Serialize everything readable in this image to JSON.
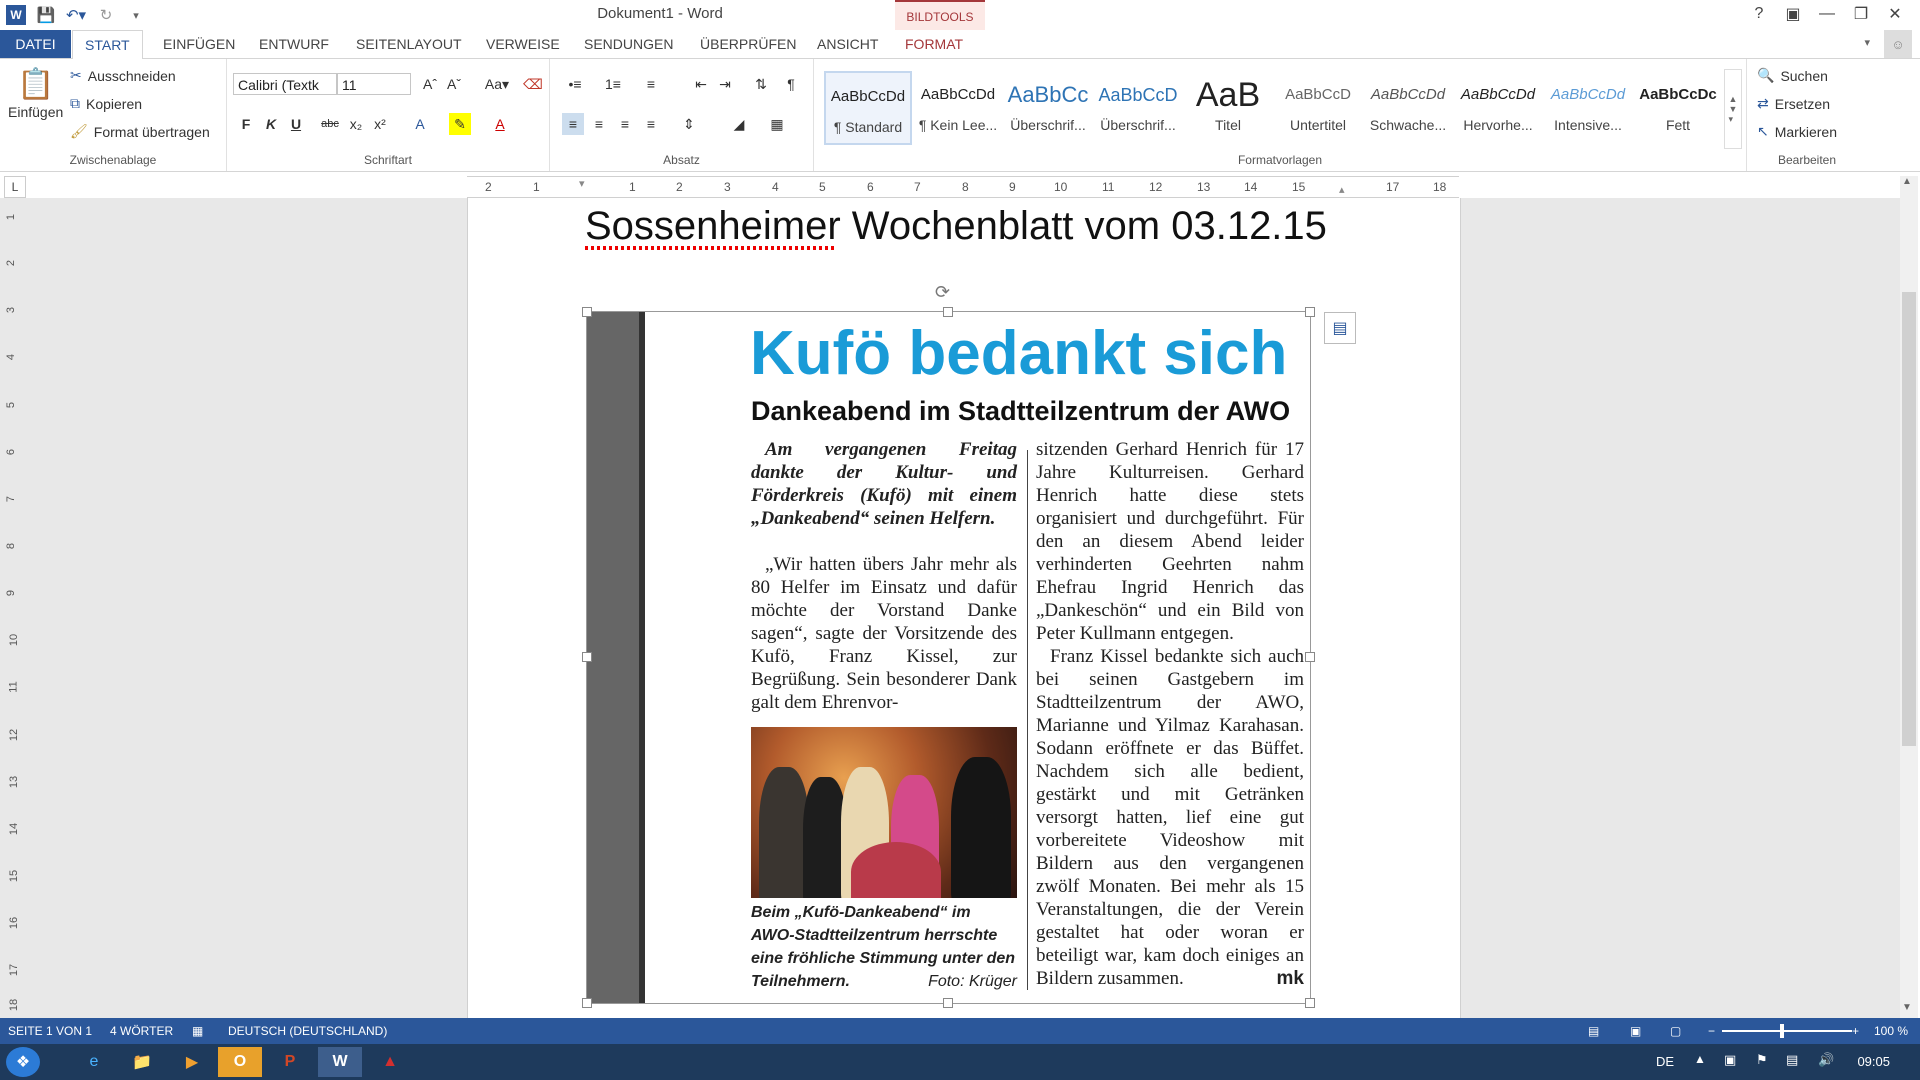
{
  "window": {
    "title": "Dokument1 - Word",
    "contextual_tab_group": "BILDTOOLS",
    "help": "?",
    "controls": [
      "restore-ribbon",
      "minimize",
      "maximize",
      "close"
    ]
  },
  "tabs": [
    "DATEI",
    "START",
    "EINFÜGEN",
    "ENTWURF",
    "SEITENLAYOUT",
    "VERWEISE",
    "SENDUNGEN",
    "ÜBERPRÜFEN",
    "ANSICHT",
    "FORMAT"
  ],
  "active_tab": "START",
  "ribbon": {
    "clipboard": {
      "paste": "Einfügen",
      "cut": "Ausschneiden",
      "copy": "Kopieren",
      "format_painter": "Format übertragen",
      "label": "Zwischenablage"
    },
    "font": {
      "name": "Calibri (Textk",
      "size": "11",
      "bold": "F",
      "italic": "K",
      "underline": "U",
      "strike": "abc",
      "sub": "x₂",
      "sup": "x²",
      "label": "Schriftart"
    },
    "paragraph": {
      "label": "Absatz"
    },
    "styles": {
      "label": "Formatvorlagen",
      "items": [
        {
          "sample": "AaBbCcDd",
          "name": "¶ Standard"
        },
        {
          "sample": "AaBbCcDd",
          "name": "¶ Kein Lee..."
        },
        {
          "sample": "AaBbCc",
          "name": "Überschrif..."
        },
        {
          "sample": "AaBbCcD",
          "name": "Überschrif..."
        },
        {
          "sample": "AaB",
          "name": "Titel"
        },
        {
          "sample": "AaBbCcD",
          "name": "Untertitel"
        },
        {
          "sample": "AaBbCcDd",
          "name": "Schwache..."
        },
        {
          "sample": "AaBbCcDd",
          "name": "Hervorhe..."
        },
        {
          "sample": "AaBbCcDd",
          "name": "Intensive..."
        },
        {
          "sample": "AaBbCcDc",
          "name": "Fett"
        }
      ]
    },
    "editing": {
      "find": "Suchen",
      "replace": "Ersetzen",
      "select": "Markieren",
      "label": "Bearbeiten"
    }
  },
  "ruler": {
    "corner": "L",
    "h_ticks": [
      "2",
      "1",
      "1",
      "2",
      "3",
      "4",
      "5",
      "6",
      "7",
      "8",
      "9",
      "10",
      "11",
      "12",
      "13",
      "14",
      "15",
      "17",
      "18"
    ],
    "v_ticks": [
      "1",
      "2",
      "3",
      "4",
      "5",
      "6",
      "7",
      "8",
      "9",
      "10",
      "11",
      "12",
      "13",
      "14",
      "15",
      "16",
      "17",
      "18"
    ]
  },
  "document": {
    "heading": "Sossenheimer Wochenblatt vom 03.12.15",
    "clipping": {
      "headline": "Kufö bedankt sich",
      "subheadline": "Dankeabend im Stadtteilzentrum der AWO",
      "col1_lead": "Am vergangenen Freitag dankte der Kultur- und Förderkreis (Kufö) mit einem „Dankeabend“ seinen Helfern.",
      "col1_body": "„Wir hatten übers Jahr mehr als 80 Helfer im Einsatz und dafür möchte der Vorstand Danke sagen“, sagte der Vorsitzende des Kufö, Franz Kissel, zur Begrüßung. Sein besonderer Dank galt dem Ehrenvor-",
      "caption": "Beim „Kufö-Dankeabend“ im AWO-Stadtteilzentrum herrschte eine fröhliche Stimmung unter den Teilnehmern.",
      "caption_credit": "Foto: Krüger",
      "col2_p1": "sitzenden Gerhard Henrich für 17 Jahre Kulturreisen. Gerhard Henrich hatte diese stets organisiert und durchgeführt. Für den an diesem Abend leider verhinderten Geehrten nahm Ehefrau Ingrid Henrich das „Dankeschön“ und ein Bild von Peter Kullmann entgegen.",
      "col2_p2": "Franz Kissel bedankte sich auch bei seinen Gastgebern im Stadtteilzentrum der AWO, Marianne und Yilmaz Karahasan. Sodann eröffnete er das Büffet. Nachdem sich alle bedient, gestärkt und mit Getränken versorgt hatten, lief eine gut vorbereitete Videoshow mit Bildern aus den vergangenen zwölf Monaten. Bei mehr als 15 Veranstaltungen, die der Verein gestaltet hat oder woran er beteiligt war, kam doch einiges an Bildern zusammen.",
      "signature": "mk"
    }
  },
  "status": {
    "page": "SEITE 1 VON 1",
    "words": "4 WÖRTER",
    "language": "DEUTSCH (DEUTSCHLAND)",
    "zoom": "100 %"
  },
  "taskbar": {
    "lang": "DE",
    "time": "09:05"
  },
  "colors": {
    "word_blue": "#2b579a",
    "headline_blue": "#1a9bd7",
    "format_red": "#a4373a"
  }
}
